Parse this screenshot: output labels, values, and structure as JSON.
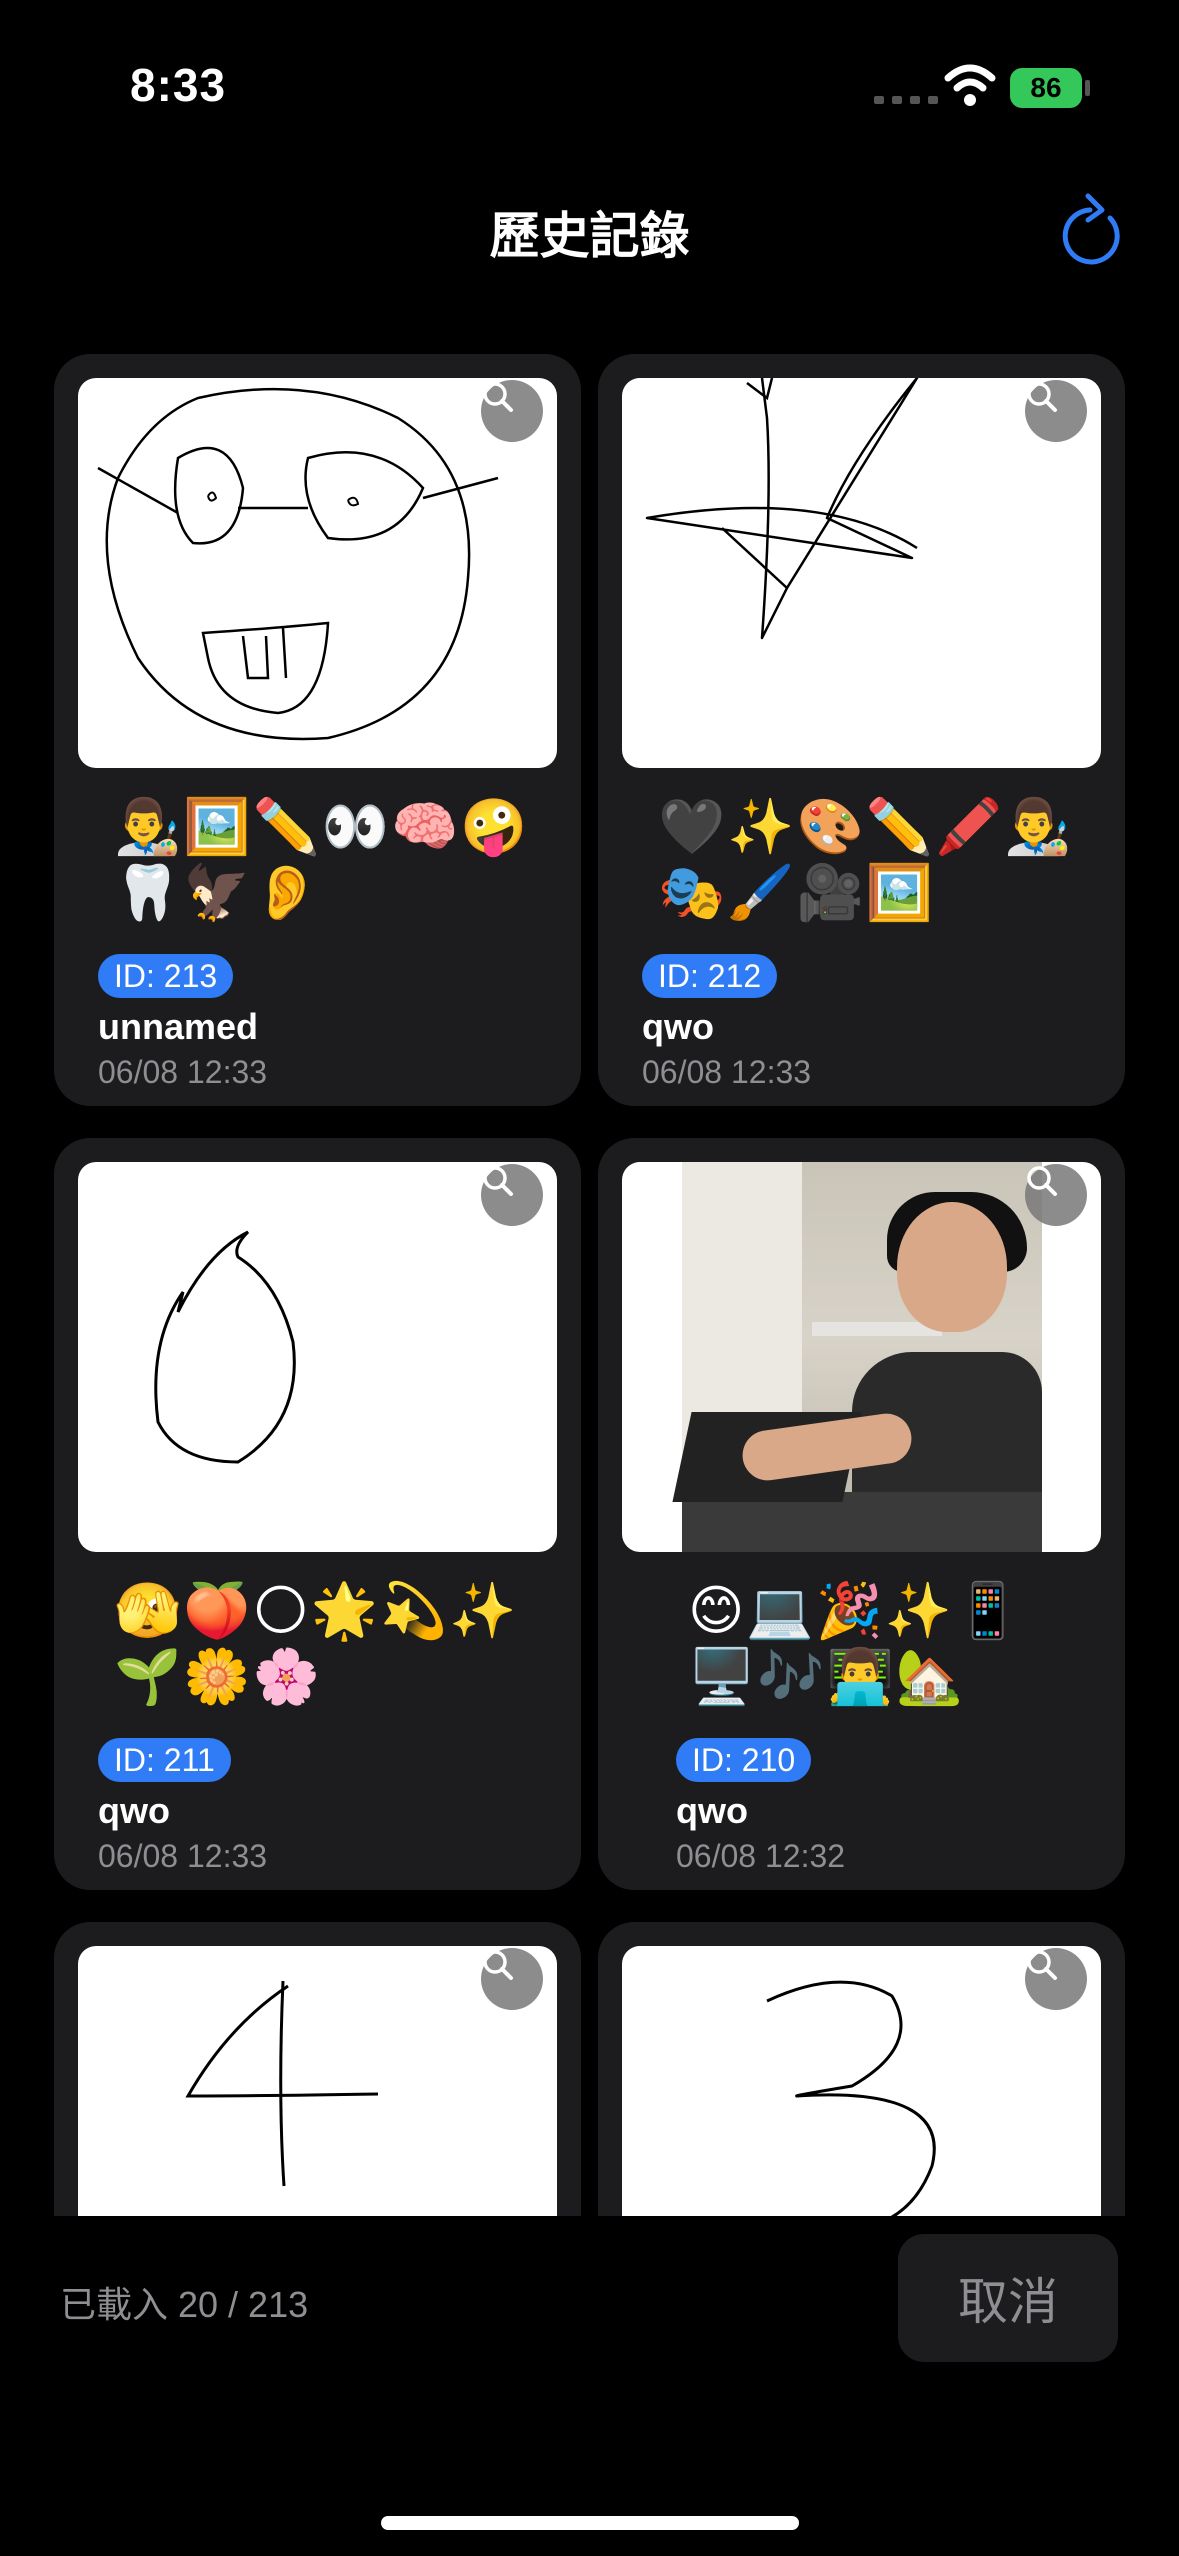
{
  "status": {
    "time": "8:33",
    "battery": "86"
  },
  "nav": {
    "title": "歷史記錄",
    "refresh_icon": "refresh-icon"
  },
  "cards": [
    {
      "id_label": "ID: 213",
      "name": "unnamed",
      "date": "06/08 12:33",
      "emojis_line1": "👨‍🎨🖼️✏️👀🧠🤪",
      "emojis_line2": "🦷🦅👂"
    },
    {
      "id_label": "ID: 212",
      "name": "qwo",
      "date": "06/08 12:33",
      "emojis_line1": "🖤✨🎨✏️🖍️👨‍🎨",
      "emojis_line2": "🎭🖌️🎥🖼️"
    },
    {
      "id_label": "ID: 211",
      "name": "qwo",
      "date": "06/08 12:33",
      "emojis_line1": "🫣🍑🌕🌟💫✨",
      "emojis_line2": "🌱🌼🌸"
    },
    {
      "id_label": "ID: 210",
      "name": "qwo",
      "date": "06/08 12:32",
      "emojis_line1": "😊💻🎉✨📱",
      "emojis_line2": "🖥️🎶👨‍💻🏡"
    }
  ],
  "footer": {
    "loaded_text": "已載入 20 / 213",
    "cancel_label": "取消"
  }
}
